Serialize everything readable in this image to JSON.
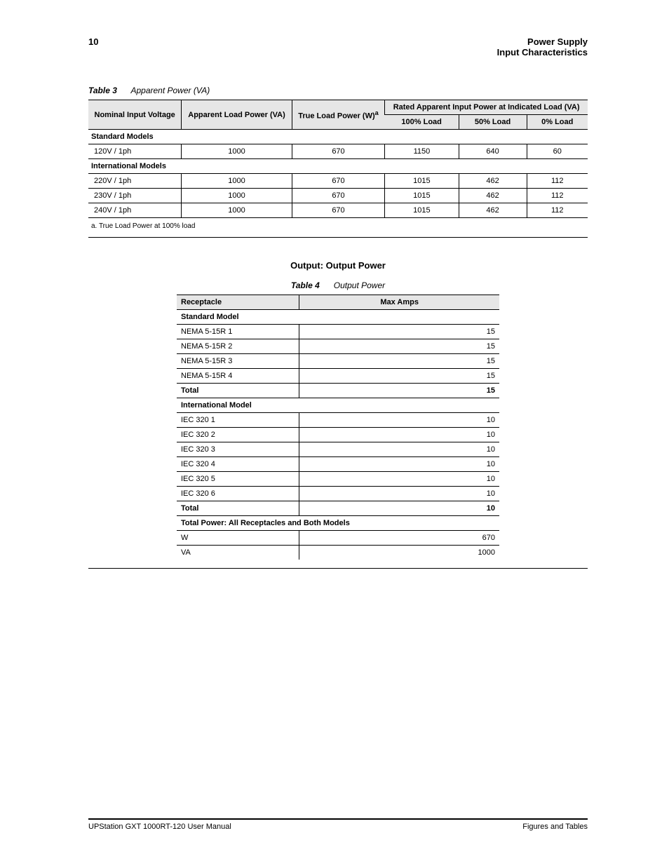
{
  "header": {
    "page_number": "10",
    "title": "Power Supply",
    "title2": "Input Characteristics"
  },
  "tableA": {
    "caption_label": "Table 3",
    "caption_text": "Apparent Power (VA)",
    "columns": {
      "c1": "Nominal Input Voltage",
      "c2": "Apparent Load Power (VA)",
      "c3": "True Load Power (W)",
      "c4_group": "Rated Apparent Input Power at Indicated Load (VA)",
      "c4a": "100% Load",
      "c4b": "50% Load",
      "c4c": "0% Load"
    },
    "sections": [
      {
        "title": "Standard Models",
        "rows": [
          {
            "c1": "120V / 1ph",
            "c2": "1000",
            "c3": "670",
            "c4a": "1150",
            "c4b": "640",
            "c4c": "60"
          }
        ]
      },
      {
        "title": "International Models",
        "rows": [
          {
            "c1": "220V / 1ph",
            "c2": "1000",
            "c3": "670",
            "c4a": "1015",
            "c4b": "462",
            "c4c": "112"
          },
          {
            "c1": "230V / 1ph",
            "c2": "1000",
            "c3": "670",
            "c4a": "1015",
            "c4b": "462",
            "c4c": "112"
          },
          {
            "c1": "240V / 1ph",
            "c2": "1000",
            "c3": "670",
            "c4a": "1015",
            "c4b": "462",
            "c4c": "112"
          }
        ]
      }
    ],
    "footnote_a": "a. True Load Power at 100% load"
  },
  "tableB": {
    "title_line1": "Output: Output Power",
    "caption_label": "Table 4",
    "caption_text": "Output Power",
    "columns": {
      "c1": "Receptacle",
      "c2": "Max Amps"
    },
    "sections": [
      {
        "title": "Standard Model",
        "rows": [
          {
            "c1": "NEMA 5-15R 1",
            "c2": "15"
          },
          {
            "c1": "NEMA 5-15R 2",
            "c2": "15"
          },
          {
            "c1": "NEMA 5-15R 3",
            "c2": "15"
          },
          {
            "c1": "NEMA 5-15R 4",
            "c2": "15"
          }
        ],
        "total": {
          "c1": "Total",
          "c2": "15"
        }
      },
      {
        "title": "International Model",
        "rows": [
          {
            "c1": "IEC 320 1",
            "c2": "10"
          },
          {
            "c1": "IEC 320 2",
            "c2": "10"
          },
          {
            "c1": "IEC 320 3",
            "c2": "10"
          },
          {
            "c1": "IEC 320 4",
            "c2": "10"
          },
          {
            "c1": "IEC 320 5",
            "c2": "10"
          },
          {
            "c1": "IEC 320 6",
            "c2": "10"
          }
        ],
        "total": {
          "c1": "Total",
          "c2": "10"
        }
      },
      {
        "title": "Total Power: All Receptacles and Both Models",
        "rows": [
          {
            "c1": "W",
            "c2": "670"
          },
          {
            "c1": "VA",
            "c2": "1000"
          }
        ]
      }
    ]
  },
  "footer": {
    "left": "UPStation GXT 1000RT-120 User Manual",
    "right": "Figures and Tables"
  }
}
